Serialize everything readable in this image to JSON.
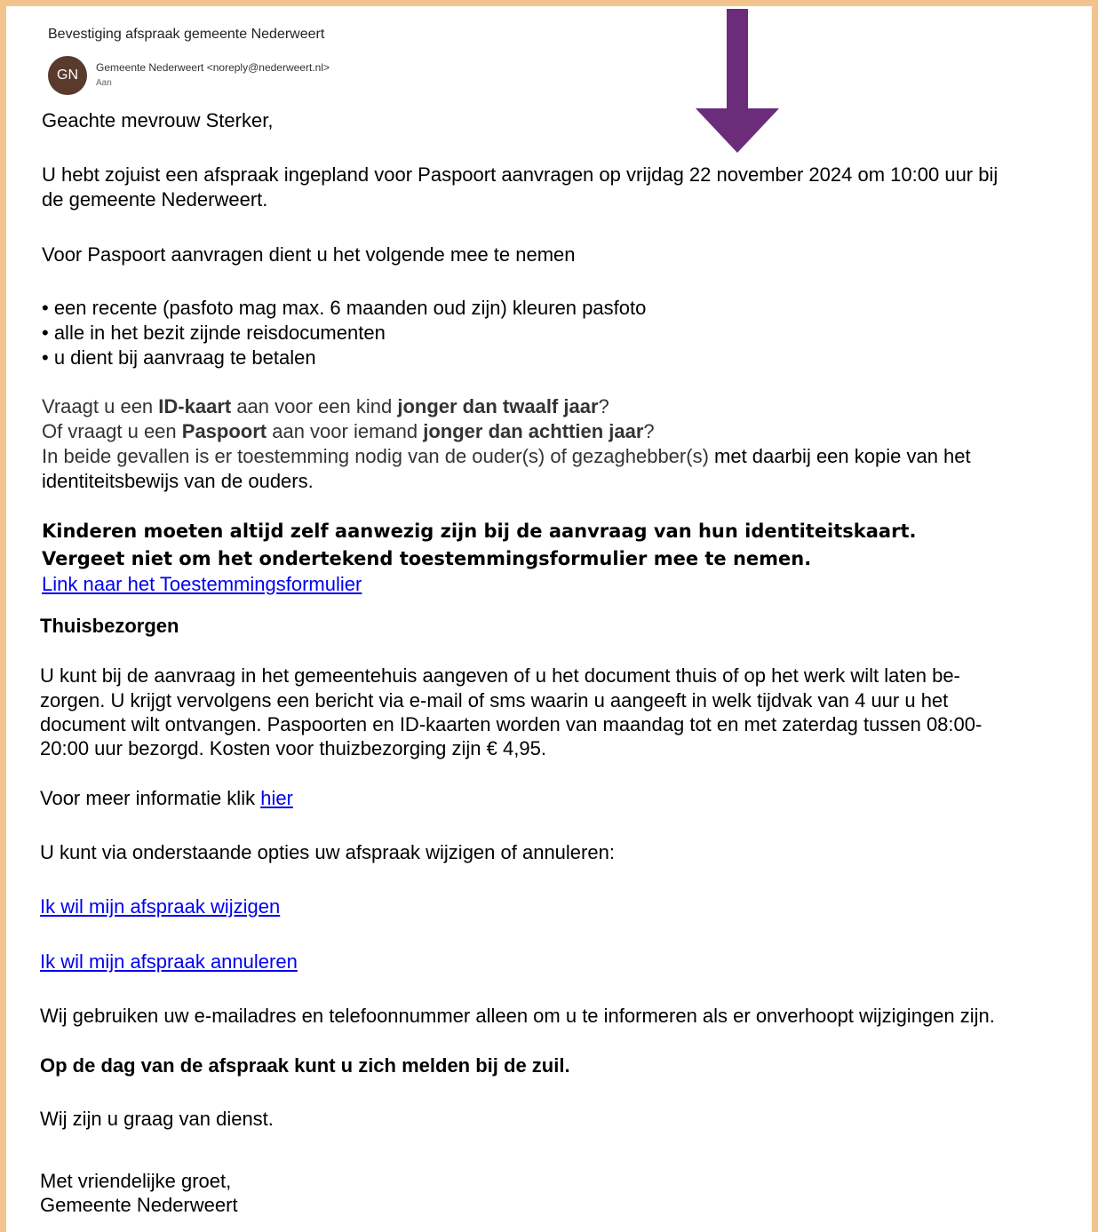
{
  "email": {
    "subject": "Bevestiging afspraak gemeente Nederweert",
    "avatar_initials": "GN",
    "sender": "Gemeente Nederweert <noreply@nederweert.nl>",
    "to_label": "Aan"
  },
  "annotation": {
    "arrow_color": "#6b2c7a",
    "arrow_icon": "arrow-down-icon"
  },
  "body": {
    "greeting": "Geachte mevrouw Sterker,",
    "appointment_line1": "U hebt zojuist een afspraak ingepland voor Paspoort aanvragen op vrijdag 22 november 2024 om 10:00 uur bij",
    "appointment_line2": "de gemeente Nederweert.",
    "bring_intro": "Voor Paspoort aanvragen dient u het volgende mee te nemen",
    "bring_items": [
      "• een recente (pasfoto mag max. 6 maanden oud zijn) kleuren pasfoto",
      "• alle in het bezit zijnde reisdocumenten",
      "• u dient bij aanvraag te betalen"
    ],
    "q1_pre": "Vraagt u een ",
    "q1_b1": "ID-kaart",
    "q1_mid": " aan voor een kind ",
    "q1_b2": "jonger dan twaalf jaar",
    "q1_end": "?",
    "q2_pre": "Of vraagt u een ",
    "q2_b1": "Paspoort",
    "q2_mid": " aan voor iemand ",
    "q2_b2": "jonger dan achttien jaar",
    "q2_end": "?",
    "consent_line1_a": "In beide gevallen is er toestemming nodig van de ouder(s) of gezaghebber(s)",
    "consent_line1_b": " met daarbij een kopie van het",
    "consent_line2": "identiteitsbewijs van de ouders.",
    "children_bold": "Kinderen moeten altijd zelf aanwezig zijn bij de aanvraag van hun identiteitskaart.",
    "forget_bold": "Vergeet niet om het ondertekend toestemmingsformulier mee te nemen.",
    "consent_link": "Link naar het Toestemmingsformulier",
    "home_heading": "Thuisbezorgen",
    "home_p": [
      "U kunt bij de aanvraag in het gemeentehuis aangeven of u het document thuis of op het werk wilt laten be-",
      "zorgen. U krijgt vervolgens een bericht via e-mail of sms waarin u aangeeft in welk tijdvak van 4 uur u het",
      "document wilt ontvangen. Paspoorten en ID-kaarten worden van maandag tot en met zaterdag tussen 08:00-",
      "20:00 uur bezorgd. Kosten voor thuizbezorging zijn € 4,95."
    ],
    "more_info_pre": "Voor meer informatie klik ",
    "more_info_link": "hier",
    "options_intro": "U kunt via onderstaande opties uw afspraak wijzigen of annuleren:",
    "change_link": "Ik wil mijn afspraak wijzigen",
    "cancel_link": "Ik wil mijn afspraak annuleren",
    "privacy": "Wij gebruiken uw e-mailadres en telefoonnummer alleen om u te informeren als er onverhoopt wijzigingen zijn.",
    "zuil_bold": "Op de dag van de afspraak kunt u zich melden bij de zuil.",
    "service": "Wij zijn u graag van dienst.",
    "closing": "Met vriendelijke groet,",
    "signature": "Gemeente Nederweert"
  }
}
